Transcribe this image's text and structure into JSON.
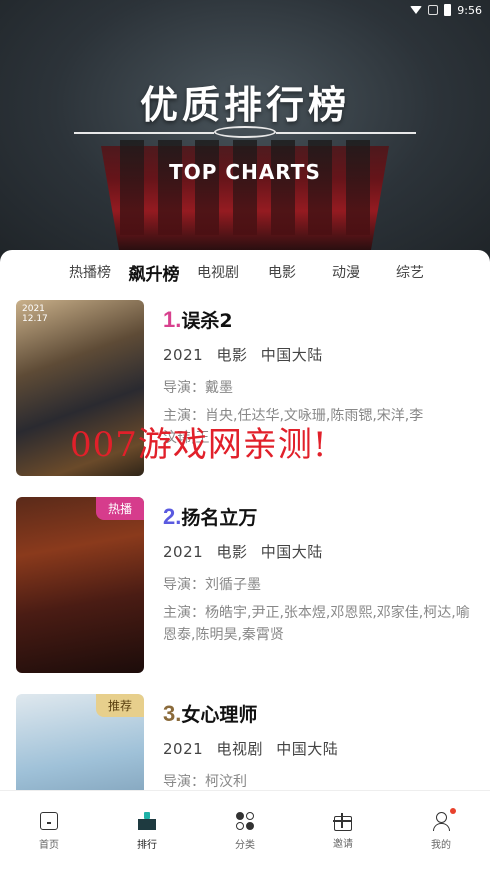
{
  "status_bar": {
    "time": "9:56"
  },
  "banner": {
    "title": "优质排行榜",
    "subtitle": "TOP CHARTS"
  },
  "tabs": [
    {
      "label": "热播榜"
    },
    {
      "label": "飙升榜",
      "active": true
    },
    {
      "label": "电视剧"
    },
    {
      "label": "电影"
    },
    {
      "label": "动漫"
    },
    {
      "label": "综艺"
    }
  ],
  "items": [
    {
      "rank": "1.",
      "title": "误杀2",
      "year": "2021",
      "type": "电影",
      "region": "中国大陆",
      "director": "导演：戴墨",
      "cast": "主演：肖央,任达华,文咏珊,陈雨锶,宋洋,李",
      "cast_line2": "汶玮,王",
      "poster_text": "2021\n12.17",
      "badge": ""
    },
    {
      "rank": "2.",
      "title": "扬名立万",
      "year": "2021",
      "type": "电影",
      "region": "中国大陆",
      "director": "导演：刘循子墨",
      "cast": "主演：杨皓宇,尹正,张本煜,邓恩熙,邓家佳,柯达,喻恩泰,陈明昊,秦霄贤",
      "badge": "热播"
    },
    {
      "rank": "3.",
      "title": "女心理师",
      "year": "2021",
      "type": "电视剧",
      "region": "中国大陆",
      "director": "导演：柯汶利",
      "cast": "",
      "badge": "推荐"
    }
  ],
  "watermark": "007游戏网亲测!",
  "bottom_nav": [
    {
      "label": "首页",
      "icon": "home-icon"
    },
    {
      "label": "排行",
      "icon": "ranking-icon",
      "active": true
    },
    {
      "label": "分类",
      "icon": "category-icon"
    },
    {
      "label": "邀请",
      "icon": "gift-icon"
    },
    {
      "label": "我的",
      "icon": "profile-icon"
    }
  ],
  "colors": {
    "accent": "#d8418e",
    "rank2": "#5a5ae0",
    "rank3": "#8a6a3a",
    "notify": "#e8412c"
  }
}
